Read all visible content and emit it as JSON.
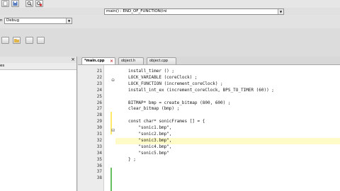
{
  "toolbar": {
    "icons": [
      "file-icon",
      "save-icon",
      "search-icon",
      "find-replace-icon"
    ]
  },
  "function_combo": {
    "value": "main() : END_OF_FUNCTION(ini"
  },
  "config_combo": {
    "value": "Debug",
    "prefix": "n"
  },
  "left_panel": {
    "header": "es"
  },
  "tabs": [
    {
      "label": "*main.cpp",
      "active": true
    },
    {
      "label": "object.h",
      "active": false
    },
    {
      "label": "object.cpp",
      "active": false
    }
  ],
  "code": {
    "lines": [
      {
        "num": "21",
        "text": "install_timer () ;"
      },
      {
        "num": "22",
        "text": "LOCK_VARIABLE (coreClock) ;"
      },
      {
        "num": "23",
        "text": "LOCK_FUNCTION (increment_coreClock) ;"
      },
      {
        "num": "24",
        "text": "install_int_ex (increment_coreClock, BPS_TO_TIMER (60)) ;"
      },
      {
        "num": "25",
        "text": ""
      },
      {
        "num": "26",
        "text": "BITMAP* bmp = create_bitmap (800, 600) ;"
      },
      {
        "num": "27",
        "text": "clear_bitmap (bmp) ;"
      },
      {
        "num": "28",
        "text": ""
      },
      {
        "num": "29",
        "text": "const char* sonicFrames [] = {"
      },
      {
        "num": "30",
        "text": "    \"sonic1.bmp\","
      },
      {
        "num": "31",
        "text": "    \"sonic2.bmp\","
      },
      {
        "num": "32",
        "text": "    \"sonic3.bmp\","
      },
      {
        "num": "33",
        "text": "    \"sonic4.bmp\","
      },
      {
        "num": "34",
        "text": "    \"sonic5.bmp\""
      },
      {
        "num": "35",
        "text": "} ;"
      },
      {
        "num": "36",
        "text": ""
      },
      {
        "num": "37",
        "text": ""
      },
      {
        "num": "38",
        "text": ""
      }
    ]
  },
  "colors": {
    "current_line": "#fffbc8",
    "change_marker": "#ffe96a",
    "keyword": "#0000a0"
  }
}
